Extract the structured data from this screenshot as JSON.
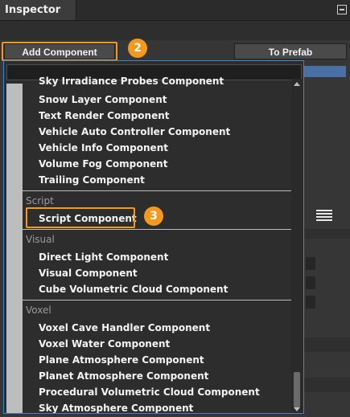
{
  "window": {
    "title": "Inspector"
  },
  "toolbar": {
    "add_component_label": "Add Component",
    "to_prefab_label": "To Prefab"
  },
  "badges": {
    "step_add": "2",
    "step_script": "3"
  },
  "colors": {
    "highlight": "#f39a1e",
    "dropdown_border": "#3f86c9"
  },
  "icons": {
    "pin": "pin-icon",
    "menu": "hamburger-menu-icon"
  },
  "dropdown": {
    "search_value": "",
    "partial_top_item": "Sky Irradiance Probes Component",
    "groups": [
      {
        "category": "",
        "items": [
          "Snow Layer Component",
          "Text Render Component",
          "Vehicle Auto Controller Component",
          "Vehicle Info Component",
          "Volume Fog Component",
          "Trailing Component"
        ]
      },
      {
        "category": "Script",
        "items": [
          "Script Component"
        ]
      },
      {
        "category": "Visual",
        "items": [
          "Direct Light Component",
          "Visual Component",
          "Cube Volumetric Cloud Component"
        ]
      },
      {
        "category": "Voxel",
        "items": [
          "Voxel Cave Handler Component",
          "Voxel Water Component",
          "Plane Atmosphere Component",
          "Planet Atmosphere Component",
          "Procedural Volumetric Cloud Component",
          "Sky Atmosphere Component"
        ]
      }
    ]
  }
}
